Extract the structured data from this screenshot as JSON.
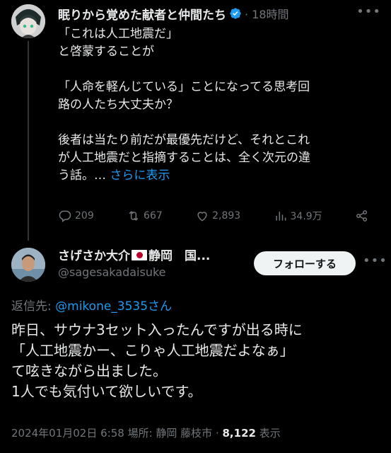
{
  "tweet1": {
    "name": "眠りから覚めた献者と仲間たち",
    "time": "· 18時間",
    "body": [
      "「これは人工地震だ」",
      "と啓蒙することが",
      "",
      "「人命を軽んじている」ことになってる思考回",
      "路の人たち大丈夫か？",
      "",
      "後者は当たり前だが最優先だけど、それとこれ",
      "が人工地震だと指摘することは、全く次元の違",
      "う話。…"
    ],
    "show_more": "さらに表示",
    "replies": "209",
    "retweets": "667",
    "likes": "2,893",
    "views": "34.9万"
  },
  "tweet2": {
    "name_a": "さげさか大介",
    "name_b": "静岡　国...",
    "handle": "@sagesakadaisuke",
    "follow_label": "フォローする",
    "reply_prefix": "返信先: ",
    "reply_to": "@mikone_3535さん",
    "body": [
      "昨日、サウナ3セット入ったんですが出る時に",
      "「人工地震かー、こりゃ人工地震だよなぁ」",
      "て呟きながら出ました。",
      "1人でも気付いて欲しいです。"
    ],
    "meta_date": "2024年01月02日 6:58",
    "meta_sep1": " 場所: ",
    "meta_location": "静岡 藤枝市",
    "meta_sep2": " · ",
    "meta_views": "8,122",
    "meta_views_label": " 表示"
  },
  "colors": {
    "accent": "#1d9bf0",
    "muted": "#71767b",
    "text": "#e7e9ea",
    "background": "#000000"
  },
  "icons": [
    "verified-icon",
    "more-icon",
    "reply-icon",
    "retweet-icon",
    "like-icon",
    "views-icon",
    "share-icon",
    "jp-flag-icon"
  ]
}
